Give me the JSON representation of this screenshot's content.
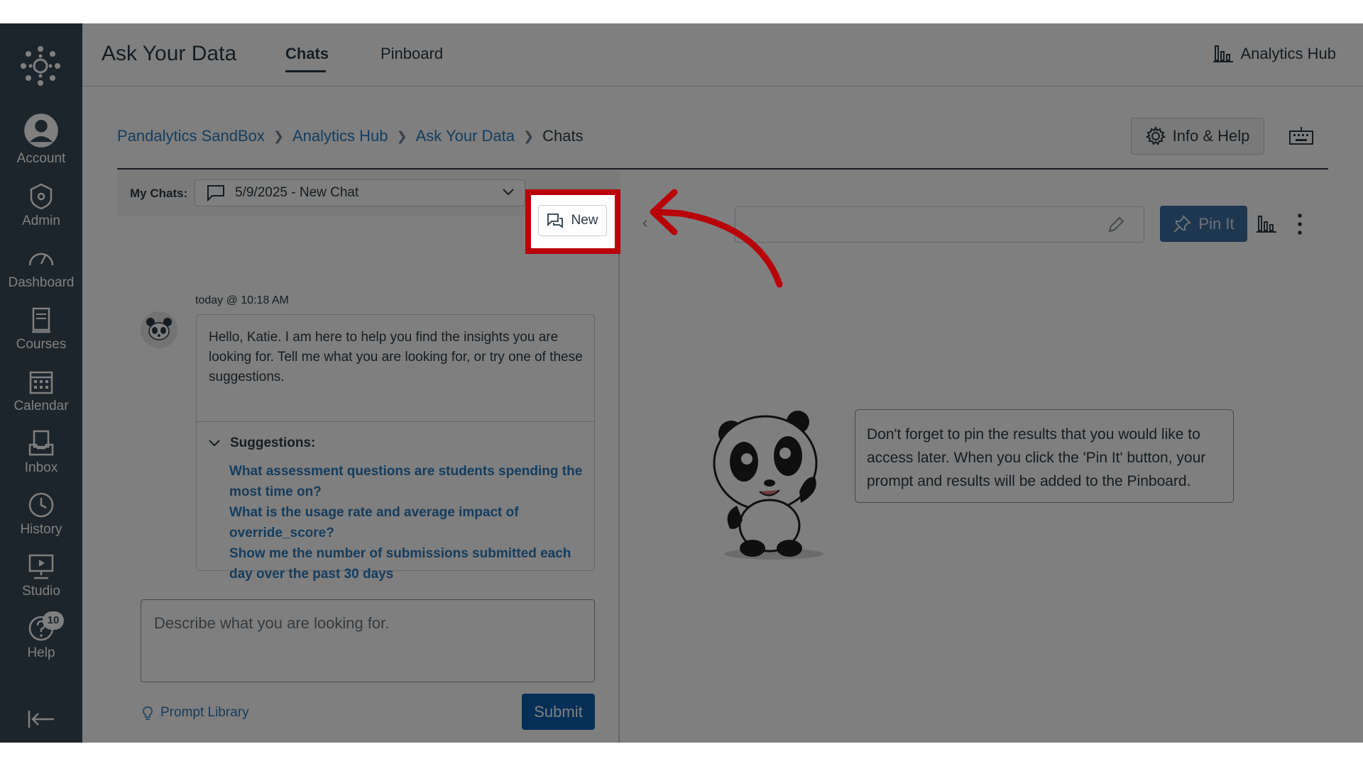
{
  "nav": {
    "items": [
      {
        "label": "Account",
        "icon": "account-icon"
      },
      {
        "label": "Admin",
        "icon": "admin-icon"
      },
      {
        "label": "Dashboard",
        "icon": "dashboard-icon"
      },
      {
        "label": "Courses",
        "icon": "courses-icon"
      },
      {
        "label": "Calendar",
        "icon": "calendar-icon"
      },
      {
        "label": "Inbox",
        "icon": "inbox-icon"
      },
      {
        "label": "History",
        "icon": "history-icon"
      },
      {
        "label": "Studio",
        "icon": "studio-icon"
      },
      {
        "label": "Help",
        "icon": "help-icon"
      }
    ],
    "help_badge": "10"
  },
  "header": {
    "title": "Ask Your Data",
    "tabs": [
      {
        "label": "Chats"
      },
      {
        "label": "Pinboard"
      }
    ],
    "analytics_hub": "Analytics Hub"
  },
  "breadcrumb": [
    "Pandalytics SandBox",
    "Analytics Hub",
    "Ask Your Data",
    "Chats"
  ],
  "info_help": "Info & Help",
  "toolbar": {
    "my_chats_label": "My Chats:",
    "selected_chat": "5/9/2025 - New Chat",
    "new_label": "New",
    "pin_label": "Pin It"
  },
  "chat": {
    "timestamp": "today @ 10:18 AM",
    "message": "Hello, Katie. I am here to help you find the insights you are looking for. Tell me what you are looking for, or try one of these suggestions.",
    "suggestions_label": "Suggestions:",
    "suggestions": [
      "What assessment questions are students spending the most time on?",
      "What is the usage rate and average impact of override_score?",
      "Show me the number of submissions submitted each day over the past 30 days"
    ]
  },
  "prompt": {
    "placeholder": "Describe what you are looking for.",
    "library": "Prompt Library",
    "submit": "Submit"
  },
  "tip": "Don't forget to pin the results that you would like to access later. When you click the 'Pin It' button, your prompt and results will be added to the Pinboard.",
  "colors": {
    "nav_bg": "#394b58",
    "link": "#2b7abc",
    "highlight": "#b8000a",
    "submit": "#0b5fae"
  }
}
